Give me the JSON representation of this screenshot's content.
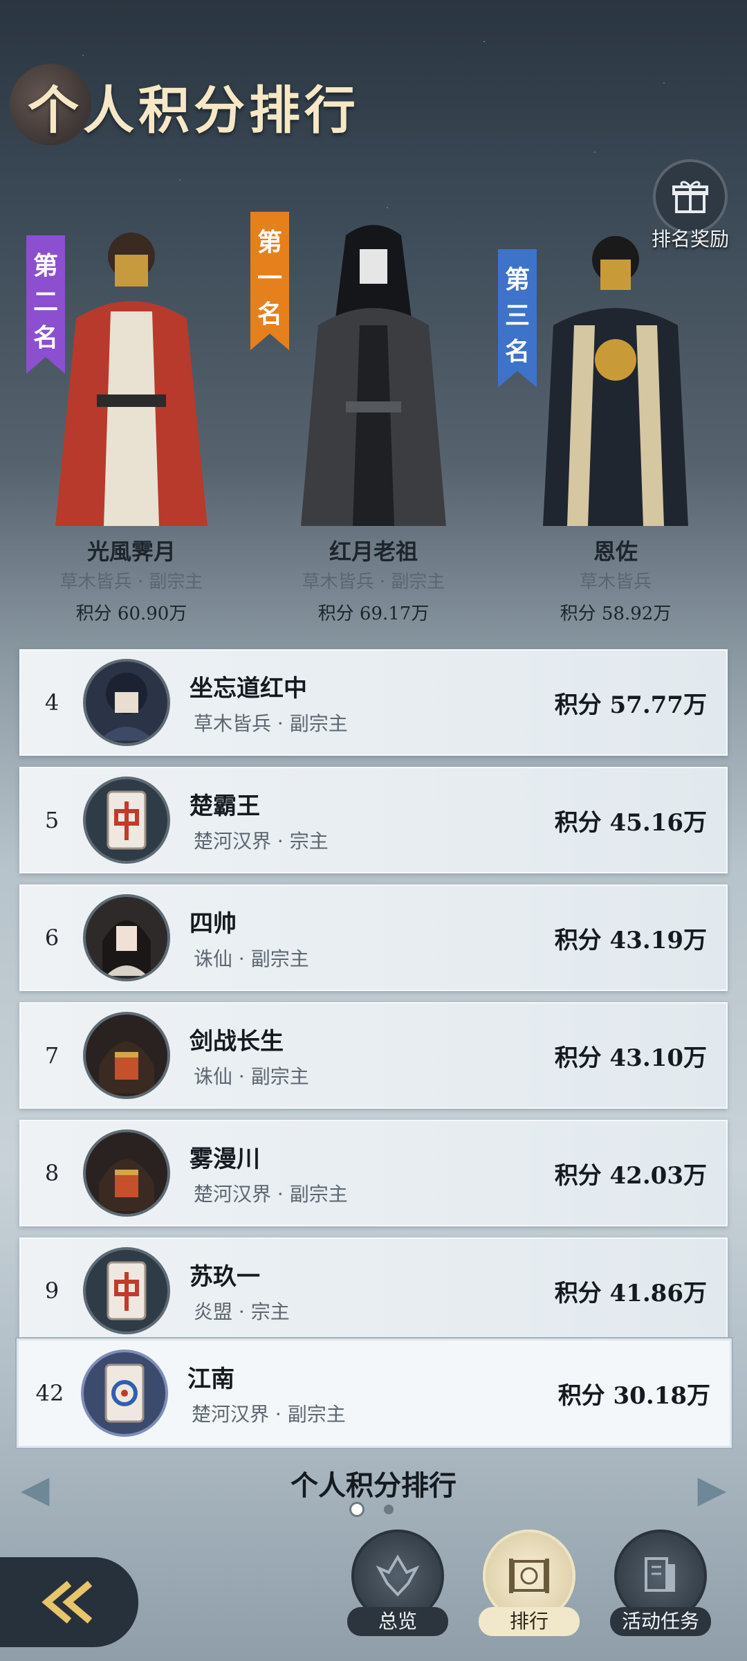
{
  "header": {
    "title": "个人积分排行",
    "reward_label": "排名奖励"
  },
  "podium": [
    {
      "banner": "第二名",
      "name": "光風霁月",
      "guild": "草木皆兵 · 副宗主",
      "score": "积分 60.90万",
      "banner_color": "#8b4fd0"
    },
    {
      "banner": "第一名",
      "name": "红月老祖",
      "guild": "草木皆兵 · 副宗主",
      "score": "积分 69.17万",
      "banner_color": "#e6801c"
    },
    {
      "banner": "第三名",
      "name": "恩佐",
      "guild": "草木皆兵",
      "score": "积分 58.92万",
      "banner_color": "#3d73c9"
    }
  ],
  "ranking": [
    {
      "rank": "4",
      "name": "坐忘道红中",
      "guild": "草木皆兵 · 副宗主",
      "score": "积分 57.77万"
    },
    {
      "rank": "5",
      "name": "楚霸王",
      "guild": "楚河汉界 · 宗主",
      "score": "积分 45.16万"
    },
    {
      "rank": "6",
      "name": "四帅",
      "guild": "诛仙 · 副宗主",
      "score": "积分 43.19万"
    },
    {
      "rank": "7",
      "name": "剑战长生",
      "guild": "诛仙 · 副宗主",
      "score": "积分 43.10万"
    },
    {
      "rank": "8",
      "name": "雾漫川",
      "guild": "楚河汉界 · 副宗主",
      "score": "积分 42.03万"
    },
    {
      "rank": "9",
      "name": "苏玖一",
      "guild": "炎盟 · 宗主",
      "score": "积分 41.86万"
    }
  ],
  "me": {
    "rank": "42",
    "name": "江南",
    "guild": "楚河汉界 · 副宗主",
    "score": "积分 30.18万"
  },
  "footer": {
    "title": "个人积分排行"
  },
  "nav": {
    "overview": "总览",
    "rank": "排行",
    "tasks": "活动任务"
  }
}
